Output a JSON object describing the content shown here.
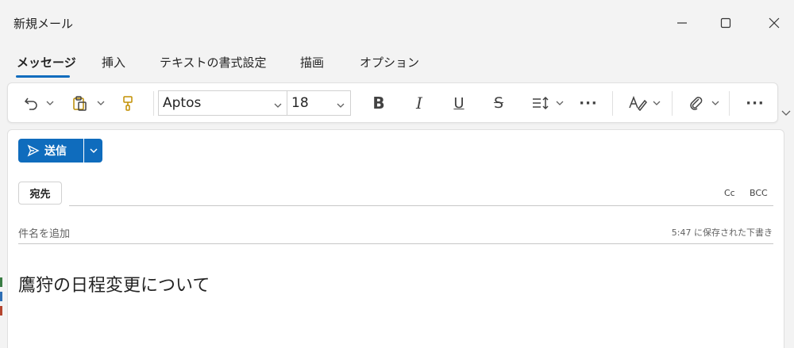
{
  "window": {
    "title": "新規メール"
  },
  "tabs": [
    {
      "label": "メッセージ",
      "active": true
    },
    {
      "label": "挿入",
      "active": false
    },
    {
      "label": "テキストの書式設定",
      "active": false
    },
    {
      "label": "描画",
      "active": false
    },
    {
      "label": "オプション",
      "active": false
    }
  ],
  "ribbon": {
    "font_name": "Aptos",
    "font_size": "18",
    "bold_glyph": "B",
    "italic_glyph": "I",
    "underline_glyph": "U",
    "strike_glyph": "S",
    "more_glyph": "···"
  },
  "compose": {
    "send_label": "送信",
    "to_label": "宛先",
    "cc_label": "Cc",
    "bcc_label": "BCC",
    "subject_placeholder": "件名を追加",
    "saved_status": "5:47 に保存された下書き",
    "body": "鷹狩の日程変更について"
  },
  "colors": {
    "accent": "#0f6cbd",
    "background": "#f3f3f3"
  }
}
